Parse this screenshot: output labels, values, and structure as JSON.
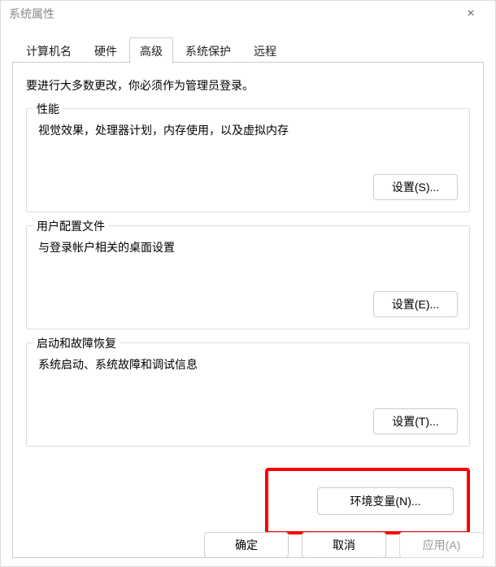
{
  "window": {
    "title": "系统属性",
    "close_glyph": "×"
  },
  "tabs": {
    "items": [
      {
        "label": "计算机名"
      },
      {
        "label": "硬件"
      },
      {
        "label": "高级"
      },
      {
        "label": "系统保护"
      },
      {
        "label": "远程"
      }
    ],
    "active_index": 2
  },
  "panel": {
    "intro": "要进行大多数更改，你必须作为管理员登录。",
    "groups": [
      {
        "legend": "性能",
        "desc": "视觉效果，处理器计划，内存使用，以及虚拟内存",
        "button": "设置(S)..."
      },
      {
        "legend": "用户配置文件",
        "desc": "与登录帐户相关的桌面设置",
        "button": "设置(E)..."
      },
      {
        "legend": "启动和故障恢复",
        "desc": "系统启动、系统故障和调试信息",
        "button": "设置(T)..."
      }
    ],
    "env_button": "环境变量(N)..."
  },
  "footer": {
    "ok": "确定",
    "cancel": "取消",
    "apply": "应用(A)"
  }
}
